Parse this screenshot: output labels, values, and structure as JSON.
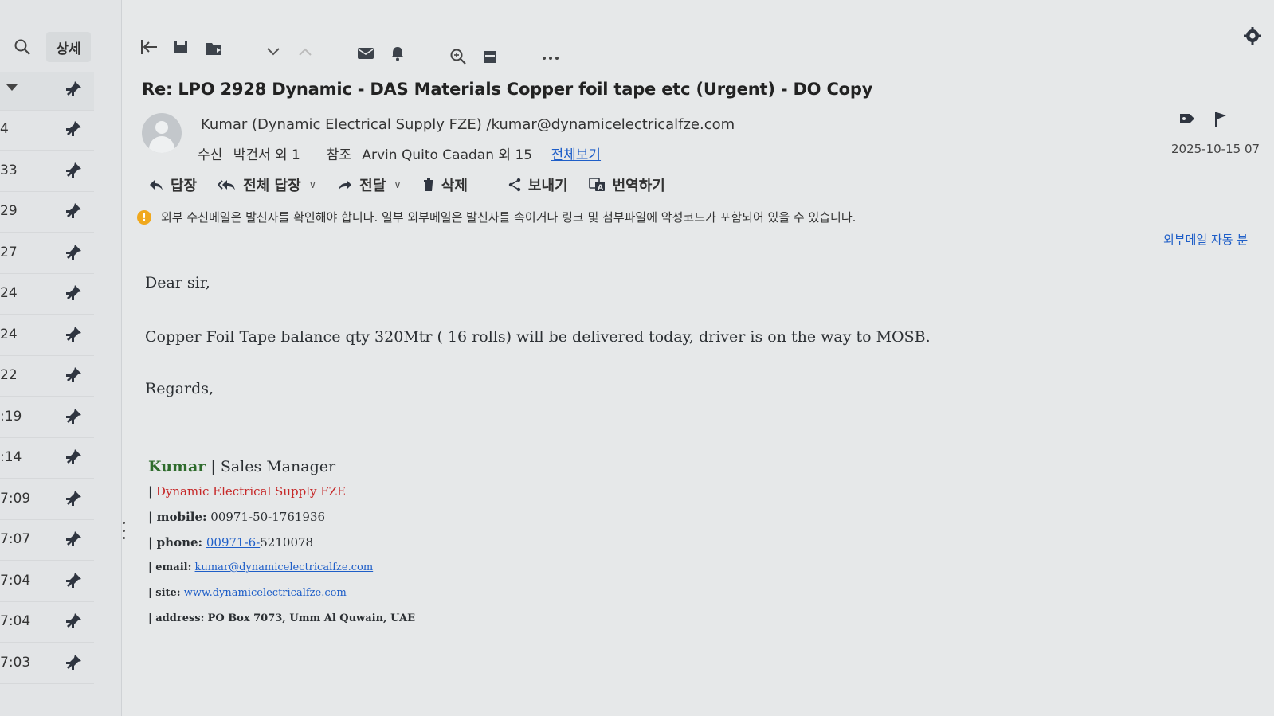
{
  "list": {
    "detail_label": "상세",
    "times": [
      "4",
      "33",
      "29",
      "27",
      "24",
      "24",
      "22",
      ":19",
      ":14",
      "7:09",
      "7:07",
      "7:04",
      "7:04",
      "7:03"
    ]
  },
  "message": {
    "subject": "Re: LPO 2928 Dynamic - DAS Materials Copper foil tape etc (Urgent) - DO Copy",
    "sender": "Kumar (Dynamic Electrical Supply FZE) /kumar@dynamicelectricalfze.com",
    "to_label": "수신",
    "to_value": "박건서 외 1",
    "cc_label": "참조",
    "cc_value": "Arvin Quito Caadan 외 15",
    "view_all": "전체보기",
    "date": "2025-10-15 07"
  },
  "actions": {
    "reply": "답장",
    "reply_all": "전체 답장",
    "forward": "전달",
    "delete": "삭제",
    "send": "보내기",
    "translate": "번역하기"
  },
  "warning": {
    "icon": "!",
    "text": "외부 수신메일은 발신자를 확인해야 합니다. 일부 외부메일은 발신자를 속이거나 링크 및 첨부파일에 악성코드가 포함되어 있을 수 있습니다.",
    "link": "외부메일 자동 분"
  },
  "body": {
    "greeting": "Dear sir,",
    "line1": "Copper Foil Tape balance qty 320Mtr ( 16 rolls) will be delivered today, driver is on the way to MOSB.",
    "closing": "Regards,"
  },
  "signature": {
    "name": "Kumar",
    "title": " | Sales Manager",
    "company_prefix": "| ",
    "company": "Dynamic Electrical Supply FZE",
    "mobile_label": "| mobile:",
    "mobile": " 00971-50-1761936",
    "phone_label": "| phone:",
    "phone_link": "00971-6-",
    "phone_rest": "5210078",
    "email_label": "| email:",
    "email": "kumar@dynamicelectricalfze.com",
    "site_label": "| site:",
    "site": "www.dynamicelectricalfze.com",
    "address_label": "| address:",
    "address": "PO Box 7073, Umm Al Quwain, UAE"
  },
  "colors": {
    "accent_link": "#1e5ec8",
    "warning": "#f0a81d",
    "company": "#c62828",
    "signature_name": "#2e6b2c"
  }
}
